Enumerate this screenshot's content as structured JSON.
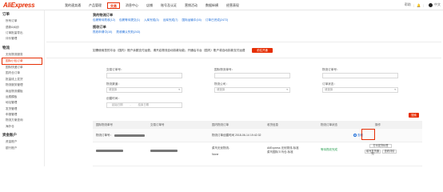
{
  "logo": "AliExpress",
  "nav": {
    "items": [
      {
        "label": "我的速卖通",
        "active": false
      },
      {
        "label": "产品管理",
        "active": false
      },
      {
        "label": "交易",
        "active": true
      },
      {
        "label": "消息中心",
        "active": false
      },
      {
        "label": "店铺",
        "active": false
      },
      {
        "label": "账号及认证",
        "active": false
      },
      {
        "label": "营销活动",
        "active": false
      },
      {
        "label": "数据纵横",
        "active": false
      },
      {
        "label": "经营表现",
        "active": false
      }
    ]
  },
  "topright": {
    "help": "帮助",
    "lang": "中文"
  },
  "sidebar": {
    "groups": [
      {
        "title": "订单",
        "items": [
          {
            "label": "所有订单",
            "active": false
          },
          {
            "label": "退款&纠纷",
            "active": false
          },
          {
            "label": "订单批量导出",
            "active": false
          },
          {
            "label": "评价管理",
            "active": false
          }
        ]
      },
      {
        "title": "物流",
        "items": [
          {
            "label": "无忧物流服务",
            "active": false
          },
          {
            "label": "国际小包订单",
            "active": true
          },
          {
            "label": "国际快递订单",
            "active": false
          },
          {
            "label": "国内仓订单",
            "active": false
          },
          {
            "label": "批量线上发货",
            "active": false
          },
          {
            "label": "物流服务管理",
            "active": false
          },
          {
            "label": "商品物流模板",
            "active": false
          },
          {
            "label": "运费模板",
            "active": false
          },
          {
            "label": "地址管理",
            "active": false
          },
          {
            "label": "发货管理",
            "active": false
          },
          {
            "label": "申报管理",
            "active": false
          },
          {
            "label": "物流方案查询",
            "active": false
          },
          {
            "label": "海外仓",
            "active": false
          }
        ]
      },
      {
        "title": "资金账户",
        "items": [
          {
            "label": "资金账户",
            "active": false
          },
          {
            "label": "银行账户",
            "active": false
          }
        ]
      }
    ]
  },
  "orders_section": {
    "title": "我的物流订单",
    "filters_row1": [
      "包裹等待揽收(12)",
      "包裹等待提交(1)",
      "入库完成(3)",
      "出库完成(7)",
      "国际运输中(16)",
      "订单已完成(2472)"
    ],
    "title2": "揽收订单",
    "filters_row2": [
      "揽收申请中(10)",
      "揽收确认失败(243)"
    ]
  },
  "notice": {
    "text": "如需使用您的平台（国内）账户余额支付运费，请开启物流自动扣款功能；开通后平台（国内）账户将自动扣款支付运费",
    "button": "前往开通"
  },
  "form": {
    "fields": [
      {
        "label": "交易订单号：",
        "placeholder": ""
      },
      {
        "label": "国际物流单号：",
        "placeholder": ""
      },
      {
        "label": "物流订单号：",
        "placeholder": ""
      }
    ],
    "selects": [
      {
        "label": "物流渠道：",
        "value": "请选择"
      },
      {
        "label": "物流公司：",
        "value": "请选择"
      },
      {
        "label": "订单状态：",
        "value": "请选择"
      }
    ],
    "date_label": "创建时间：",
    "date_start": "起始日期",
    "date_end": "结束日期",
    "search_button": "搜索"
  },
  "table": {
    "batch_button": "批量",
    "headers": [
      "国际物流单号",
      "交易订单号",
      "国内物流订单",
      "收货信息",
      "物流订单状态",
      "操作"
    ],
    "row1": {
      "order_label": "物流订单号：",
      "created": "物流订单创建时间 2018-06-14 19:42:32",
      "detail": "查看"
    },
    "row2": {
      "carrier_line1": "菜鸟无忧物流-",
      "carrier_line2": "None",
      "warehouse_line1": "AliExpress 无忧物流-标准",
      "warehouse_line2": "菜鸟国际义乌仓-标准",
      "status": "等待揽收完成",
      "actions": [
        "打印发货标签",
        "填写发货通知",
        "查看详情"
      ]
    }
  }
}
